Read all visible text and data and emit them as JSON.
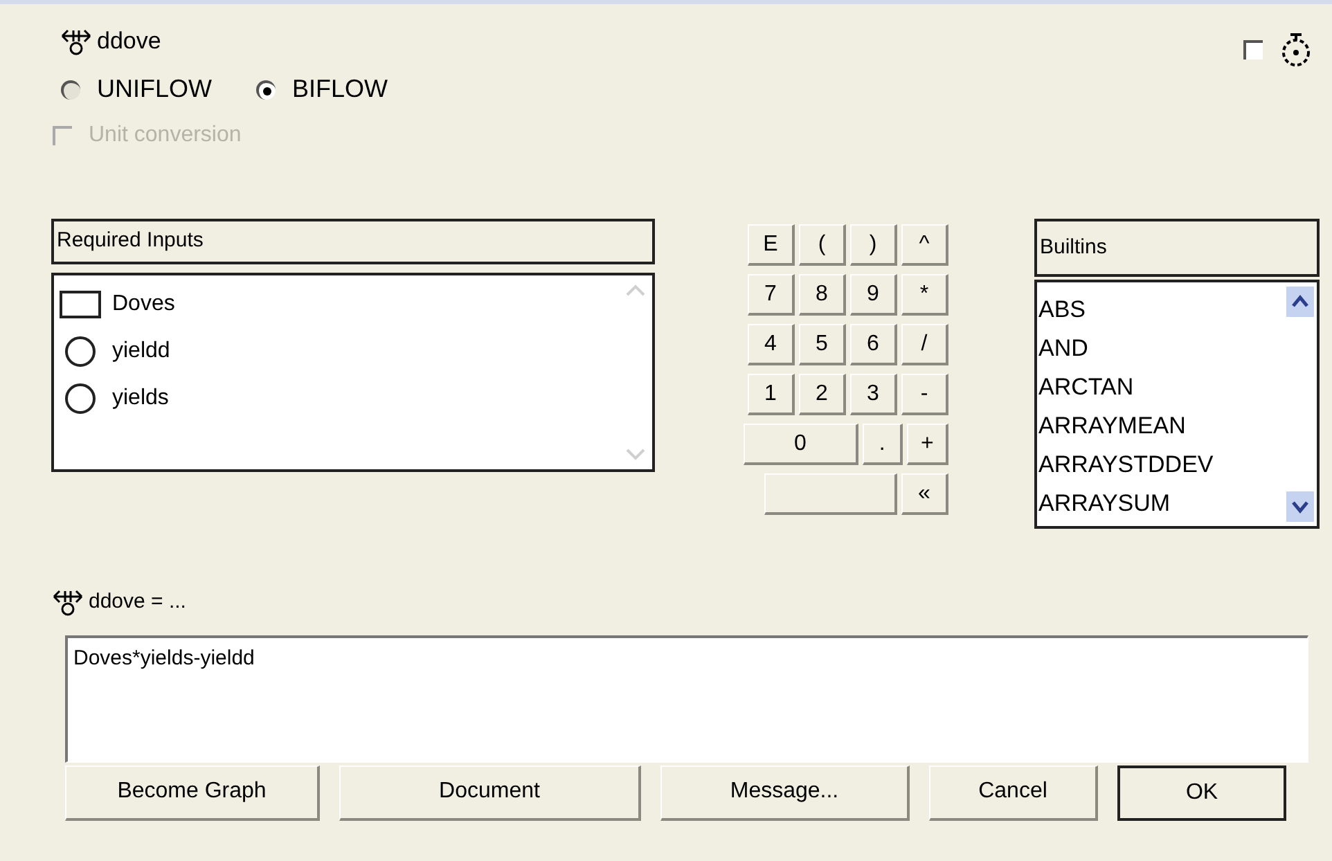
{
  "header": {
    "title": "ddove",
    "option_checked": false
  },
  "flow_modes": [
    {
      "label": "UNIFLOW",
      "selected": false
    },
    {
      "label": "BIFLOW",
      "selected": true
    }
  ],
  "unit_conversion": {
    "label": "Unit conversion",
    "checked": false,
    "disabled": true
  },
  "required_inputs": {
    "title": "Required Inputs",
    "items": [
      {
        "name": "Doves",
        "kind": "stock"
      },
      {
        "name": "yieldd",
        "kind": "converter"
      },
      {
        "name": "yields",
        "kind": "converter"
      }
    ]
  },
  "keypad": [
    [
      {
        "label": "E",
        "kind": "key"
      },
      {
        "label": "(",
        "kind": "key"
      },
      {
        "label": ")",
        "kind": "key"
      },
      {
        "label": "^",
        "kind": "key"
      }
    ],
    [
      {
        "label": "7",
        "kind": "key"
      },
      {
        "label": "8",
        "kind": "key"
      },
      {
        "label": "9",
        "kind": "key"
      },
      {
        "label": "*",
        "kind": "key"
      }
    ],
    [
      {
        "label": "4",
        "kind": "key"
      },
      {
        "label": "5",
        "kind": "key"
      },
      {
        "label": "6",
        "kind": "key"
      },
      {
        "label": "/",
        "kind": "key"
      }
    ],
    [
      {
        "label": "1",
        "kind": "key"
      },
      {
        "label": "2",
        "kind": "key"
      },
      {
        "label": "3",
        "kind": "key"
      },
      {
        "label": "-",
        "kind": "key"
      }
    ],
    [
      {
        "label": "0",
        "kind": "wide"
      },
      {
        "label": ".",
        "kind": "key"
      },
      {
        "label": "+",
        "kind": "key"
      }
    ],
    [
      {
        "kind": "blank"
      },
      {
        "label": "«",
        "kind": "key"
      }
    ]
  ],
  "builtins": {
    "title": "Builtins",
    "items": [
      "ABS",
      "AND",
      "ARCTAN",
      "ARRAYMEAN",
      "ARRAYSTDDEV",
      "ARRAYSUM"
    ]
  },
  "equation_label": "ddove = ...",
  "equation": "Doves*yields-yieldd",
  "buttons": [
    {
      "label": "Become Graph",
      "default": false
    },
    {
      "label": "Document",
      "default": false
    },
    {
      "label": "Message...",
      "default": false
    },
    {
      "label": "Cancel",
      "default": false
    },
    {
      "label": "OK",
      "default": true
    }
  ]
}
